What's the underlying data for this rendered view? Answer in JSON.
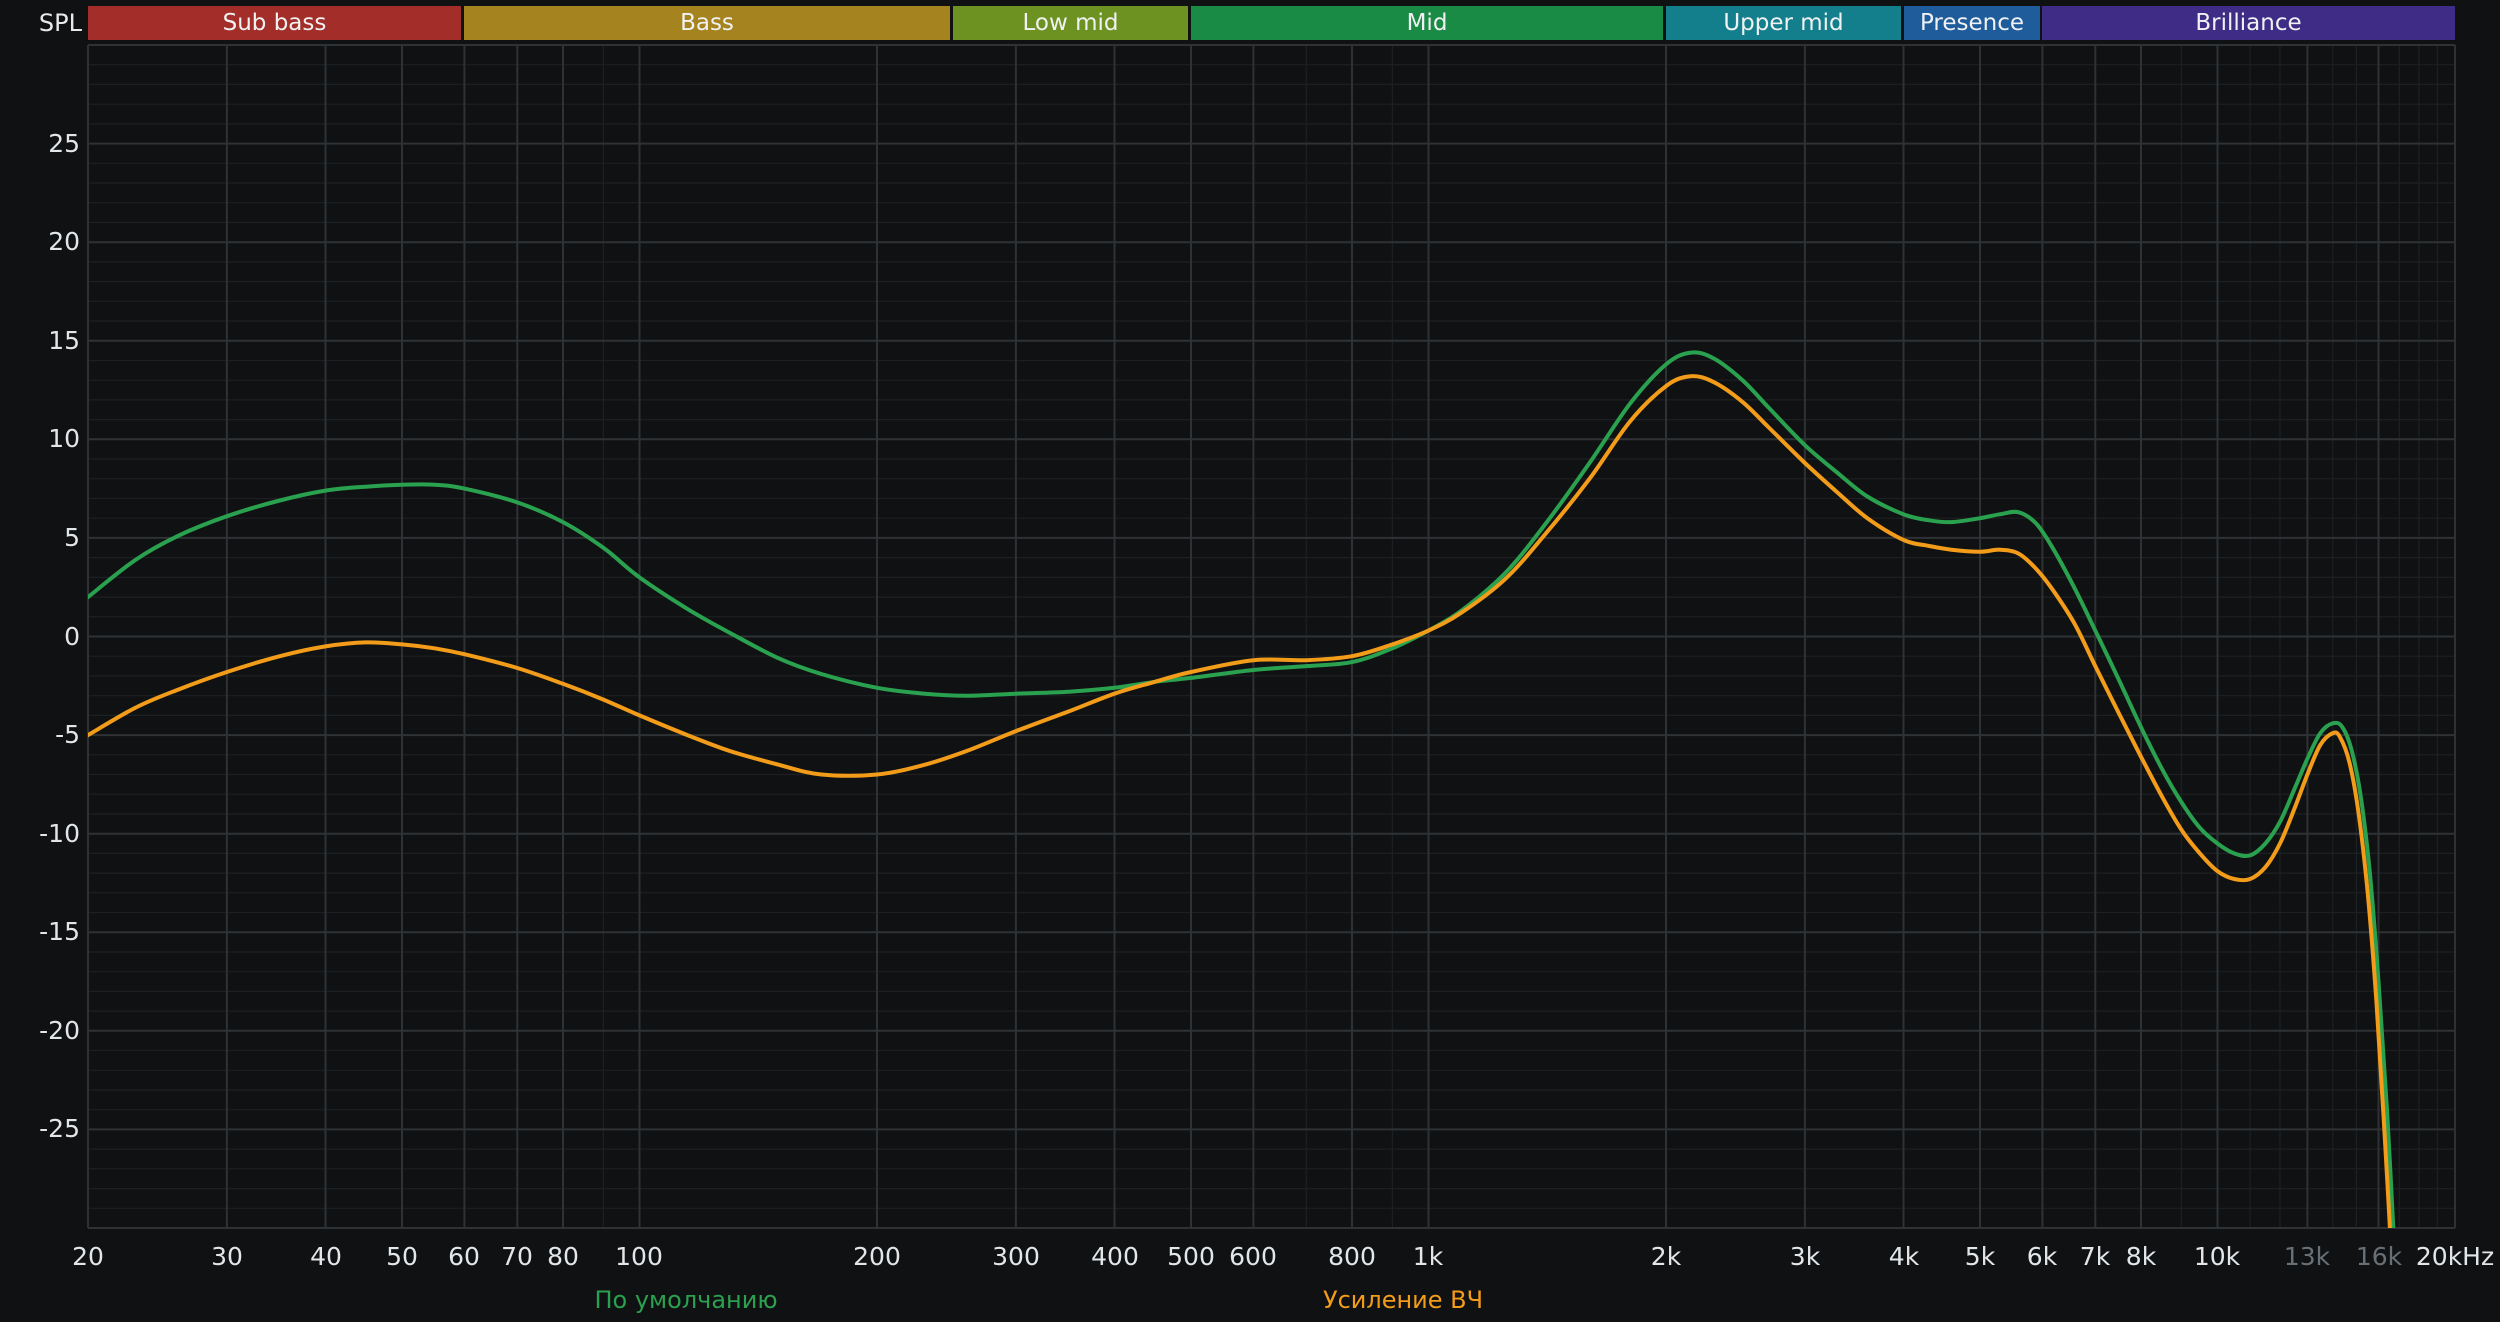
{
  "theme": {
    "bg": "#101113",
    "grid_minor": "#1d2022",
    "grid_major": "#2e3234",
    "text": "#e2e6e8",
    "text_dim": "#687077",
    "band_text": "#f0f1f2"
  },
  "axis": {
    "y_title": "SPL",
    "y_ticks": [
      25,
      20,
      15,
      10,
      5,
      0,
      -5,
      -10,
      -15,
      -20,
      -25
    ],
    "x_ticks": [
      {
        "f": 20,
        "label": "20"
      },
      {
        "f": 30,
        "label": "30"
      },
      {
        "f": 40,
        "label": "40"
      },
      {
        "f": 50,
        "label": "50"
      },
      {
        "f": 60,
        "label": "60"
      },
      {
        "f": 70,
        "label": "70"
      },
      {
        "f": 80,
        "label": "80"
      },
      {
        "f": 100,
        "label": "100"
      },
      {
        "f": 200,
        "label": "200"
      },
      {
        "f": 300,
        "label": "300"
      },
      {
        "f": 400,
        "label": "400"
      },
      {
        "f": 500,
        "label": "500"
      },
      {
        "f": 600,
        "label": "600"
      },
      {
        "f": 800,
        "label": "800"
      },
      {
        "f": 1000,
        "label": "1k"
      },
      {
        "f": 2000,
        "label": "2k"
      },
      {
        "f": 3000,
        "label": "3k"
      },
      {
        "f": 4000,
        "label": "4k"
      },
      {
        "f": 5000,
        "label": "5k"
      },
      {
        "f": 6000,
        "label": "6k"
      },
      {
        "f": 7000,
        "label": "7k"
      },
      {
        "f": 8000,
        "label": "8k"
      },
      {
        "f": 10000,
        "label": "10k"
      },
      {
        "f": 13000,
        "label": "13k",
        "dim": true
      },
      {
        "f": 16000,
        "label": "16k",
        "dim": true
      },
      {
        "f": 20000,
        "label": "20kHz"
      }
    ]
  },
  "bands": [
    {
      "label": "Sub bass",
      "color": "#a32d28",
      "from": 20,
      "to": 60
    },
    {
      "label": "Bass",
      "color": "#a5831e",
      "from": 60,
      "to": 250
    },
    {
      "label": "Low mid",
      "color": "#6e9222",
      "from": 250,
      "to": 500
    },
    {
      "label": "Mid",
      "color": "#198b45",
      "from": 500,
      "to": 2000
    },
    {
      "label": "Upper mid",
      "color": "#137f8c",
      "from": 2000,
      "to": 4000
    },
    {
      "label": "Presence",
      "color": "#1e5c9c",
      "from": 4000,
      "to": 6000
    },
    {
      "label": "Brilliance",
      "color": "#3e2c87",
      "from": 6000,
      "to": 20000
    }
  ],
  "legend": [
    {
      "label": "По умолчанию",
      "color": "#2aa14e"
    },
    {
      "label": "Усиление ВЧ",
      "color": "#f29c1a"
    }
  ],
  "chart_data": {
    "type": "line",
    "title": "",
    "ylabel": "SPL",
    "x_scale": "log",
    "x_range": [
      20,
      20000
    ],
    "y_range": [
      -30,
      30
    ],
    "grid": true,
    "legend_position": "bottom",
    "series": [
      {
        "name": "По умолчанию",
        "color": "#2aa14e",
        "points": [
          [
            20,
            2.0
          ],
          [
            23,
            3.9
          ],
          [
            26,
            5.1
          ],
          [
            30,
            6.1
          ],
          [
            35,
            6.9
          ],
          [
            40,
            7.4
          ],
          [
            45,
            7.6
          ],
          [
            50,
            7.7
          ],
          [
            55,
            7.7
          ],
          [
            60,
            7.5
          ],
          [
            70,
            6.8
          ],
          [
            80,
            5.8
          ],
          [
            90,
            4.5
          ],
          [
            100,
            3.0
          ],
          [
            115,
            1.4
          ],
          [
            130,
            0.2
          ],
          [
            150,
            -1.1
          ],
          [
            170,
            -1.9
          ],
          [
            200,
            -2.6
          ],
          [
            230,
            -2.9
          ],
          [
            260,
            -3.0
          ],
          [
            300,
            -2.9
          ],
          [
            350,
            -2.8
          ],
          [
            400,
            -2.6
          ],
          [
            450,
            -2.3
          ],
          [
            500,
            -2.1
          ],
          [
            600,
            -1.7
          ],
          [
            700,
            -1.5
          ],
          [
            800,
            -1.3
          ],
          [
            900,
            -0.6
          ],
          [
            1000,
            0.3
          ],
          [
            1100,
            1.3
          ],
          [
            1250,
            3.2
          ],
          [
            1400,
            5.6
          ],
          [
            1600,
            8.8
          ],
          [
            1800,
            11.8
          ],
          [
            2000,
            13.8
          ],
          [
            2150,
            14.4
          ],
          [
            2300,
            14.1
          ],
          [
            2500,
            13.0
          ],
          [
            2700,
            11.6
          ],
          [
            3000,
            9.7
          ],
          [
            3300,
            8.3
          ],
          [
            3600,
            7.1
          ],
          [
            4000,
            6.2
          ],
          [
            4300,
            5.9
          ],
          [
            4600,
            5.8
          ],
          [
            5000,
            6.0
          ],
          [
            5300,
            6.2
          ],
          [
            5600,
            6.3
          ],
          [
            5900,
            5.7
          ],
          [
            6200,
            4.4
          ],
          [
            6600,
            2.4
          ],
          [
            7000,
            0.3
          ],
          [
            7500,
            -2.2
          ],
          [
            8000,
            -4.6
          ],
          [
            8500,
            -6.7
          ],
          [
            9000,
            -8.4
          ],
          [
            9500,
            -9.7
          ],
          [
            10000,
            -10.5
          ],
          [
            10500,
            -11.0
          ],
          [
            11000,
            -11.1
          ],
          [
            11500,
            -10.5
          ],
          [
            12000,
            -9.4
          ],
          [
            12500,
            -7.8
          ],
          [
            13000,
            -6.2
          ],
          [
            13500,
            -4.9
          ],
          [
            14000,
            -4.4
          ],
          [
            14400,
            -4.6
          ],
          [
            14800,
            -5.8
          ],
          [
            15200,
            -8.2
          ],
          [
            15600,
            -12.0
          ],
          [
            16000,
            -17.5
          ],
          [
            16400,
            -24.0
          ],
          [
            16800,
            -32.0
          ]
        ]
      },
      {
        "name": "Усиление ВЧ",
        "color": "#f29c1a",
        "points": [
          [
            20,
            -5.0
          ],
          [
            23,
            -3.6
          ],
          [
            26,
            -2.7
          ],
          [
            30,
            -1.8
          ],
          [
            35,
            -1.0
          ],
          [
            40,
            -0.5
          ],
          [
            45,
            -0.3
          ],
          [
            50,
            -0.4
          ],
          [
            55,
            -0.6
          ],
          [
            60,
            -0.9
          ],
          [
            70,
            -1.6
          ],
          [
            80,
            -2.4
          ],
          [
            90,
            -3.2
          ],
          [
            100,
            -4.0
          ],
          [
            115,
            -5.0
          ],
          [
            130,
            -5.8
          ],
          [
            150,
            -6.5
          ],
          [
            170,
            -7.0
          ],
          [
            200,
            -7.0
          ],
          [
            230,
            -6.5
          ],
          [
            260,
            -5.8
          ],
          [
            300,
            -4.8
          ],
          [
            350,
            -3.8
          ],
          [
            400,
            -2.9
          ],
          [
            450,
            -2.3
          ],
          [
            500,
            -1.8
          ],
          [
            600,
            -1.2
          ],
          [
            700,
            -1.2
          ],
          [
            800,
            -1.0
          ],
          [
            900,
            -0.4
          ],
          [
            1000,
            0.3
          ],
          [
            1100,
            1.2
          ],
          [
            1250,
            2.9
          ],
          [
            1400,
            5.1
          ],
          [
            1600,
            8.0
          ],
          [
            1800,
            10.9
          ],
          [
            2000,
            12.7
          ],
          [
            2150,
            13.2
          ],
          [
            2300,
            12.9
          ],
          [
            2500,
            11.9
          ],
          [
            2700,
            10.6
          ],
          [
            3000,
            8.8
          ],
          [
            3300,
            7.3
          ],
          [
            3600,
            6.0
          ],
          [
            4000,
            4.9
          ],
          [
            4300,
            4.6
          ],
          [
            4600,
            4.4
          ],
          [
            5000,
            4.3
          ],
          [
            5300,
            4.4
          ],
          [
            5600,
            4.2
          ],
          [
            5900,
            3.4
          ],
          [
            6200,
            2.3
          ],
          [
            6600,
            0.6
          ],
          [
            7000,
            -1.5
          ],
          [
            7500,
            -3.9
          ],
          [
            8000,
            -6.1
          ],
          [
            8500,
            -8.1
          ],
          [
            9000,
            -9.8
          ],
          [
            9500,
            -11.0
          ],
          [
            10000,
            -11.9
          ],
          [
            10500,
            -12.3
          ],
          [
            11000,
            -12.3
          ],
          [
            11500,
            -11.7
          ],
          [
            12000,
            -10.5
          ],
          [
            12500,
            -8.8
          ],
          [
            13000,
            -7.0
          ],
          [
            13500,
            -5.5
          ],
          [
            14000,
            -4.9
          ],
          [
            14300,
            -5.1
          ],
          [
            14700,
            -6.4
          ],
          [
            15100,
            -9.0
          ],
          [
            15500,
            -13.0
          ],
          [
            15900,
            -18.5
          ],
          [
            16300,
            -25.5
          ],
          [
            16700,
            -33.0
          ]
        ]
      }
    ]
  }
}
